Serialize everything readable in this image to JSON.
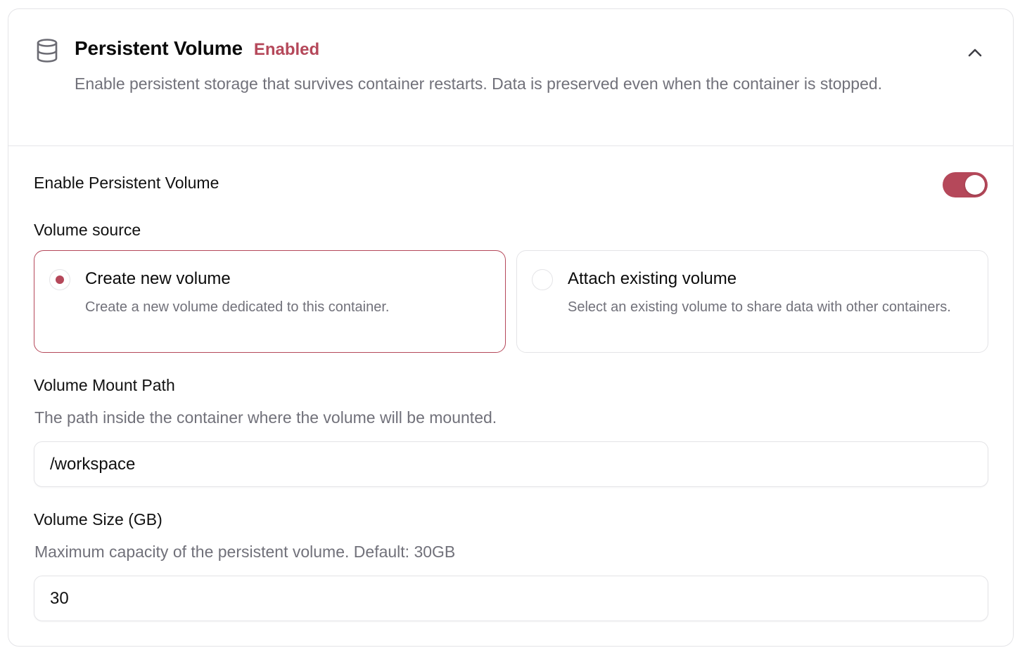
{
  "header": {
    "icon": "database-icon",
    "title": "Persistent Volume",
    "status_badge": "Enabled",
    "description": "Enable persistent storage that survives container restarts. Data is preserved even when the container is stopped.",
    "collapse_icon": "chevron-up-icon"
  },
  "toggle_row": {
    "label": "Enable Persistent Volume",
    "enabled": true
  },
  "volume_source": {
    "label": "Volume source",
    "options": [
      {
        "title": "Create new volume",
        "description": "Create a new volume dedicated to this container.",
        "selected": true
      },
      {
        "title": "Attach existing volume",
        "description": "Select an existing volume to share data with other containers.",
        "selected": false
      }
    ]
  },
  "mount_path": {
    "label": "Volume Mount Path",
    "help": "The path inside the container where the volume will be mounted.",
    "value": "/workspace"
  },
  "volume_size": {
    "label": "Volume Size (GB)",
    "help": "Maximum capacity of the persistent volume. Default: 30GB",
    "value": "30"
  },
  "colors": {
    "accent": "#b5485a",
    "muted_text": "#71717a",
    "border": "#e4e4e7"
  }
}
